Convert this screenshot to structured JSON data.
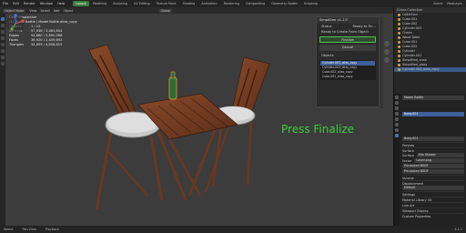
{
  "topbar": {
    "menu": [
      "File",
      "Edit",
      "Render",
      "Window",
      "Help"
    ],
    "tabs": [
      "Layout",
      "Modeling",
      "Sculpting",
      "UV Editing",
      "Texture Paint",
      "Shading",
      "Animation",
      "Rendering",
      "Compositing",
      "Geometry Nodes",
      "Scripting"
    ],
    "active_tab": "Layout",
    "scene": "Scene",
    "view_layer": "ViewLayer"
  },
  "header2": {
    "mode": "Object Mode",
    "menus": [
      "View",
      "Select",
      "Add",
      "Object"
    ],
    "orientation": "Global"
  },
  "stats": {
    "title": "User Perspective",
    "subtitle": "(1) Model Bottle | Model Bottle.alias_copy",
    "rows": [
      {
        "k": "Objects",
        "v": "1 / 15"
      },
      {
        "k": "Vertices",
        "v": "57,938 / 3,463,834"
      },
      {
        "k": "Edges",
        "v": "94,860 / 5,890,068"
      },
      {
        "k": "Faces",
        "v": "36,920 / 2,459,692"
      },
      {
        "k": "Triangles",
        "v": "34,059 / 4,858,815"
      }
    ]
  },
  "annotation": "Press Finalize",
  "npanel": {
    "title": "SimpliGen v1.1.0",
    "items": [
      {
        "label": "Status",
        "value": "Ready to Fin..."
      },
      {
        "label": "Ready to Create From Object",
        "value": ""
      }
    ],
    "finalize_label": "Finalize",
    "cancel_label": "Cancel",
    "objects_label": "Objects",
    "list": [
      "Cylinder.003_alias_copy",
      "Cylinder.003_alias_copy",
      "Cube.002_alias_copy",
      "Cube.001_alias_copy"
    ]
  },
  "outliner": {
    "title": "Scene Collection",
    "rows": [
      "Collection",
      "Cube.001",
      "Cube.002",
      "Cylinder.003",
      "Chairs",
      "Wood Table",
      "Cube.001",
      "Cube.002",
      "Cylinder",
      "Cylinder.001",
      "Simplified_chair",
      "Simplified_glass",
      "Cylinder.003_alias_copy"
    ],
    "selected_index": 12
  },
  "props": {
    "object_name": "Model Bottle",
    "modifier_name": "Body.001",
    "sections": [
      "Preview",
      "Surface",
      "Volume",
      "Displacement",
      "Settings",
      "Material Library VX",
      "Line Art",
      "Viewport Display",
      "Custom Properties"
    ],
    "surface_value": "Mix Shader",
    "fac_label": "Factor",
    "fac_value": "Layer.png",
    "shader1": "Principled BSDF",
    "shader2": "Principled BSDF",
    "displacement_value": "Default"
  },
  "statusbar": {
    "left": [
      "Select",
      "Pan View",
      "Playback"
    ],
    "right": "4.1.1"
  },
  "colors": {
    "accent_green": "#3ccd3c",
    "select_blue": "#3f5f9a",
    "viewport_bg": "#3c3c3c"
  }
}
